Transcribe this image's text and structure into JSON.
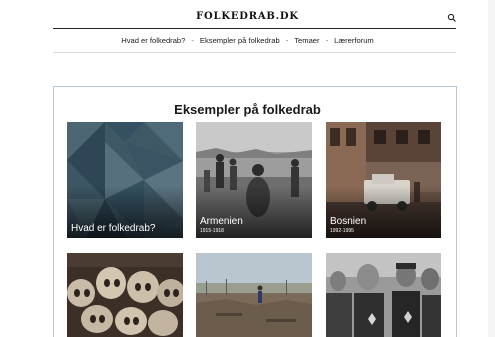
{
  "site": {
    "title": "FOLKEDRAB.DK"
  },
  "nav": {
    "items": [
      "Hvad er folkedrab?",
      "Eksempler på folkedrab",
      "Temaer",
      "Lærerforum"
    ],
    "separator": "-"
  },
  "section": {
    "title": "Eksempler på folkedrab"
  },
  "cards": [
    {
      "title": "Hvad er folkedrab?",
      "years": ""
    },
    {
      "title": "Armenien",
      "years": "1915-1918"
    },
    {
      "title": "Bosnien",
      "years": "1992-1995"
    },
    {
      "title": "",
      "years": ""
    },
    {
      "title": "",
      "years": ""
    },
    {
      "title": "",
      "years": ""
    }
  ],
  "icons": {
    "search": "search-icon"
  }
}
